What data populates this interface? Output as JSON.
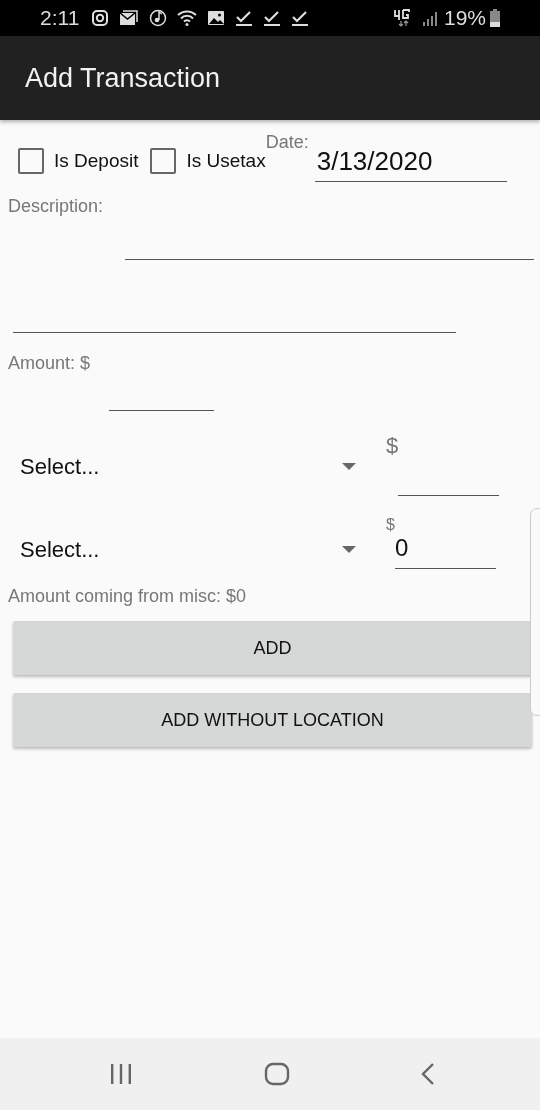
{
  "status_bar": {
    "time": "2:11",
    "battery": "19%"
  },
  "app_bar": {
    "title": "Add Transaction"
  },
  "checkboxes": [
    {
      "label": "Is Deposit",
      "checked": false
    },
    {
      "label": "Is Usetax",
      "checked": false
    }
  ],
  "date": {
    "label": "Date:",
    "value": "3/13/2020"
  },
  "description": {
    "label": "Description:"
  },
  "amount": {
    "label": "Amount: $"
  },
  "allocations": [
    {
      "select": "Select...",
      "currency": "$"
    },
    {
      "select": "Select...",
      "currency": "$",
      "value": "0"
    }
  ],
  "misc_note": "Amount coming from misc: $0",
  "buttons": [
    "ADD",
    "ADD WITHOUT LOCATION"
  ]
}
